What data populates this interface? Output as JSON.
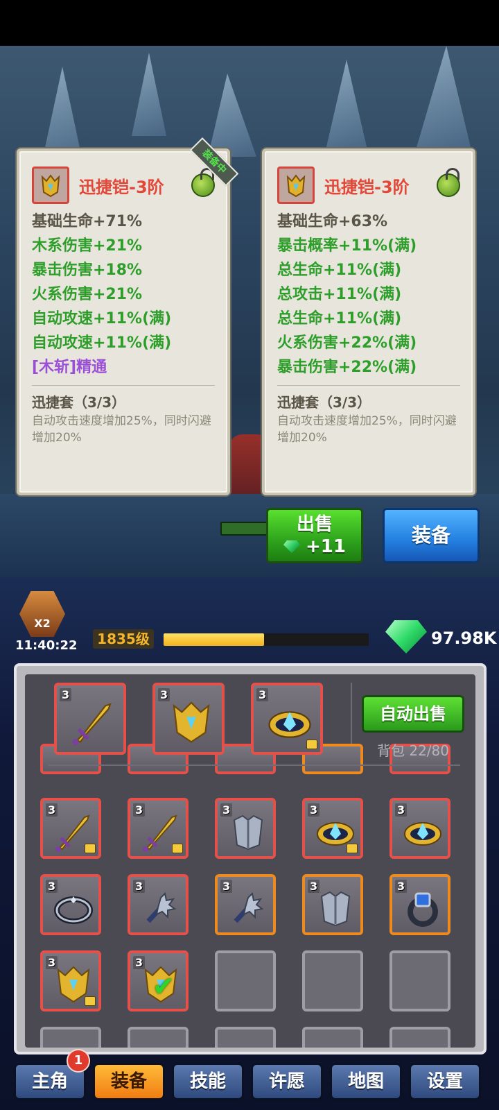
{
  "cards": {
    "left": {
      "title": "迅捷铠-3阶",
      "equipped_tag": "装备中",
      "base_stat": "基础生命+71%",
      "stats": [
        "木系伤害+21%",
        "暴击伤害+18%",
        "火系伤害+21%",
        "自动攻速+11%(满)",
        "自动攻速+11%(满)"
      ],
      "special": "[木斩]精通",
      "set_name": "迅捷套（3/3）",
      "set_desc": "自动攻击速度增加25%，同时闪避增加20%"
    },
    "right": {
      "title": "迅捷铠-3阶",
      "base_stat": "基础生命+63%",
      "stats": [
        "暴击概率+11%(满)",
        "总生命+11%(满)",
        "总攻击+11%(满)",
        "总生命+11%(满)",
        "火系伤害+22%(满)",
        "暴击伤害+22%(满)"
      ],
      "set_name": "迅捷套（3/3）",
      "set_desc": "自动攻击速度增加25%，同时闪避增加20%"
    }
  },
  "actions": {
    "sell_label": "出售",
    "sell_reward": "+11",
    "equip_label": "装备"
  },
  "status": {
    "multiplier": "X2",
    "timer": "11:40:22",
    "level": "1835级",
    "xp_fraction": 0.49,
    "gems": "97.98K"
  },
  "inventory": {
    "auto_sell_label": "自动出售",
    "bag_label": "背包 22/80",
    "tier": "3",
    "equipped_slots": [
      {
        "type": "sword"
      },
      {
        "type": "armor-gold"
      },
      {
        "type": "helm-gold",
        "locked": true
      }
    ],
    "grid": [
      {
        "type": "sword",
        "locked": true,
        "frame": "red"
      },
      {
        "type": "sword",
        "locked": true,
        "frame": "red"
      },
      {
        "type": "armor-silver",
        "frame": "red"
      },
      {
        "type": "helm-gold",
        "locked": true,
        "frame": "red"
      },
      {
        "type": "helm-gold",
        "frame": "red"
      },
      {
        "type": "ring-silver",
        "frame": "red"
      },
      {
        "type": "mace",
        "frame": "red"
      },
      {
        "type": "mace",
        "frame": "orange"
      },
      {
        "type": "armor-silver",
        "frame": "orange"
      },
      {
        "type": "ring-sapphire",
        "frame": "orange"
      },
      {
        "type": "armor-gold",
        "locked": true,
        "frame": "red"
      },
      {
        "type": "armor-gold",
        "checked": true,
        "frame": "red"
      }
    ]
  },
  "nav": {
    "tabs": [
      "主角",
      "装备",
      "技能",
      "许愿",
      "地图",
      "设置"
    ],
    "active": 1,
    "badge": "1"
  },
  "colors": {
    "title_red": "#e2483a",
    "stat_green": "#2e9e2a",
    "special_purple": "#9b4fd6",
    "frame_red": "#e4514a",
    "frame_orange": "#ee8a1e"
  }
}
